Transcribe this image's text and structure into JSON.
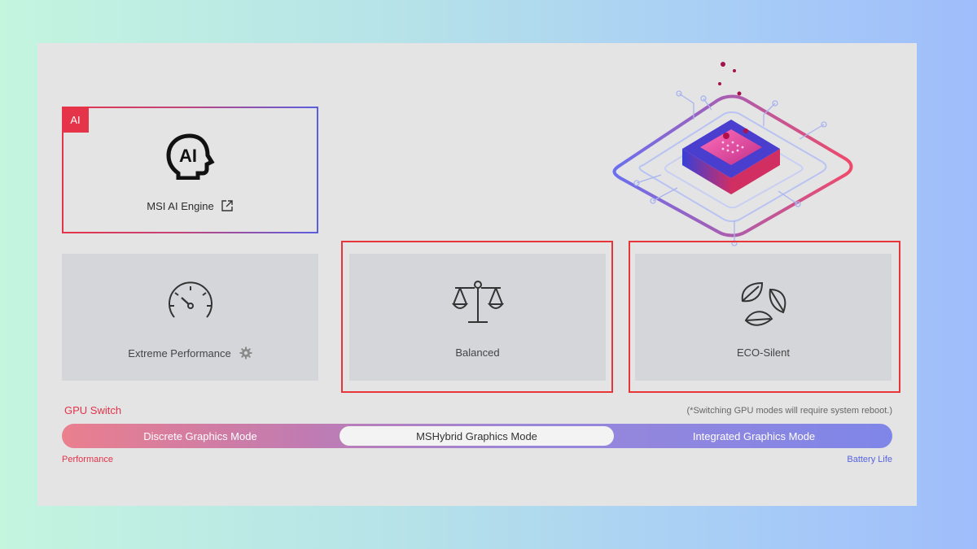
{
  "ai_engine": {
    "badge": "AI",
    "label": "MSI AI Engine",
    "head_text": "AI"
  },
  "modes": [
    {
      "label": "Extreme Performance",
      "icon": "speedometer-icon"
    },
    {
      "label": "Balanced",
      "icon": "scale-icon"
    },
    {
      "label": "ECO-Silent",
      "icon": "leaves-icon"
    }
  ],
  "gpu_switch": {
    "title": "GPU Switch",
    "note": "(*Switching GPU modes will require system reboot.)",
    "options": [
      "Discrete Graphics Mode",
      "MSHybrid Graphics Mode",
      "Integrated Graphics Mode"
    ],
    "selected": "MSHybrid Graphics Mode",
    "left_end": "Performance",
    "right_end": "Battery Life"
  },
  "colors": {
    "accent_red": "#e5334a",
    "accent_blue": "#5b5ee0",
    "highlight": "#e8353a"
  }
}
